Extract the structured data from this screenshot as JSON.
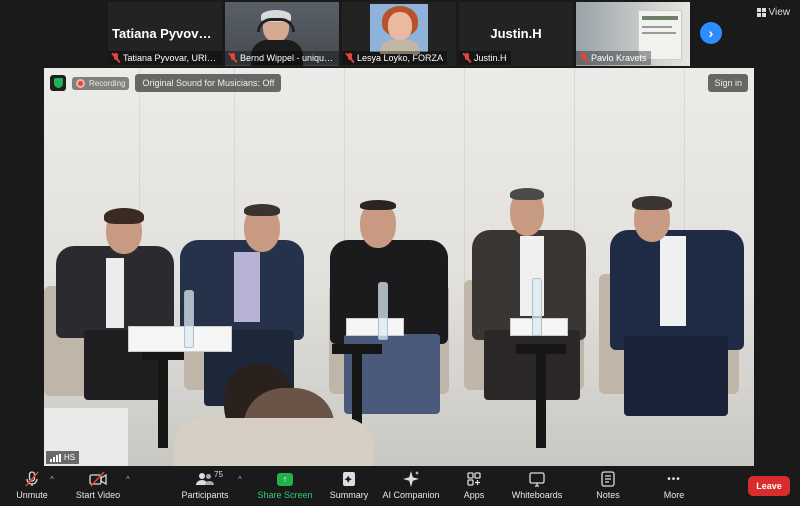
{
  "top_tiles": [
    {
      "big_name": "Tatiana  Pyvovar,...",
      "label": "Tatiana Pyvovar, URIFF..."
    },
    {
      "label": "Bernd Wippel - unique..."
    },
    {
      "label": "Lesya Loyko, FORZA"
    },
    {
      "big_name": "Justin.H",
      "label": "Justin.H"
    },
    {
      "label": "Pavlo Kravets"
    }
  ],
  "next_arrow": "›",
  "view_label": "View",
  "main": {
    "recording_label": "Recording",
    "original_sound_label": "Original Sound for Musicians: Off",
    "sign_in_label": "Sign in",
    "speaker_label": "HS"
  },
  "toolbar": {
    "unmute": "Unmute",
    "start_video": "Start Video",
    "participants": "Participants",
    "participants_count": "75",
    "share_screen": "Share Screen",
    "summary": "Summary",
    "ai_companion": "AI Companion",
    "apps": "Apps",
    "whiteboards": "Whiteboards",
    "notes": "Notes",
    "more": "More",
    "more_glyph": "•••",
    "caret": "^",
    "leave": "Leave"
  },
  "colors": {
    "accent_blue": "#2d8cff",
    "share_green": "#23b14d",
    "leave_red": "#d92d2d",
    "mic_off_red": "#e0463a"
  },
  "icons": [
    "mic-off-icon",
    "video-off-icon",
    "participants-icon",
    "share-screen-icon",
    "summary-icon",
    "ai-companion-icon",
    "apps-icon",
    "whiteboards-icon",
    "notes-icon",
    "more-icon",
    "shield-icon",
    "recording-icon",
    "view-grid-icon",
    "chevron-right-icon"
  ]
}
